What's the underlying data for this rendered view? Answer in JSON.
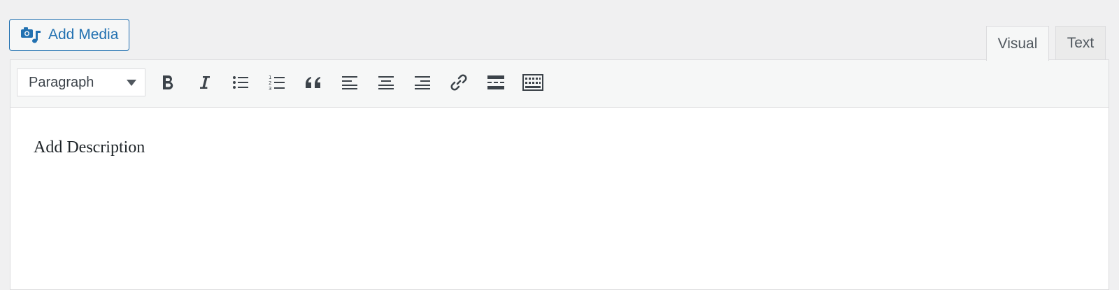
{
  "toolbar": {
    "add_media_label": "Add Media",
    "add_media_icon": "media-camera-music-icon"
  },
  "tabs": [
    {
      "label": "Visual",
      "active": true
    },
    {
      "label": "Text",
      "active": false
    }
  ],
  "format_select": {
    "value": "Paragraph"
  },
  "buttons": [
    {
      "name": "bold",
      "icon": "bold-icon"
    },
    {
      "name": "italic",
      "icon": "italic-icon"
    },
    {
      "name": "bulleted-list",
      "icon": "bulleted-list-icon"
    },
    {
      "name": "numbered-list",
      "icon": "numbered-list-icon"
    },
    {
      "name": "blockquote",
      "icon": "blockquote-icon"
    },
    {
      "name": "align-left",
      "icon": "align-left-icon"
    },
    {
      "name": "align-center",
      "icon": "align-center-icon"
    },
    {
      "name": "align-right",
      "icon": "align-right-icon"
    },
    {
      "name": "insert-link",
      "icon": "link-icon"
    },
    {
      "name": "read-more",
      "icon": "read-more-icon"
    },
    {
      "name": "toolbar-toggle",
      "icon": "keyboard-icon"
    }
  ],
  "editor": {
    "content": "Add Description"
  },
  "colors": {
    "accent": "#2271b1",
    "toolbar_bg": "#f6f7f7",
    "page_bg": "#f0f0f1",
    "icon": "#3c434a"
  }
}
